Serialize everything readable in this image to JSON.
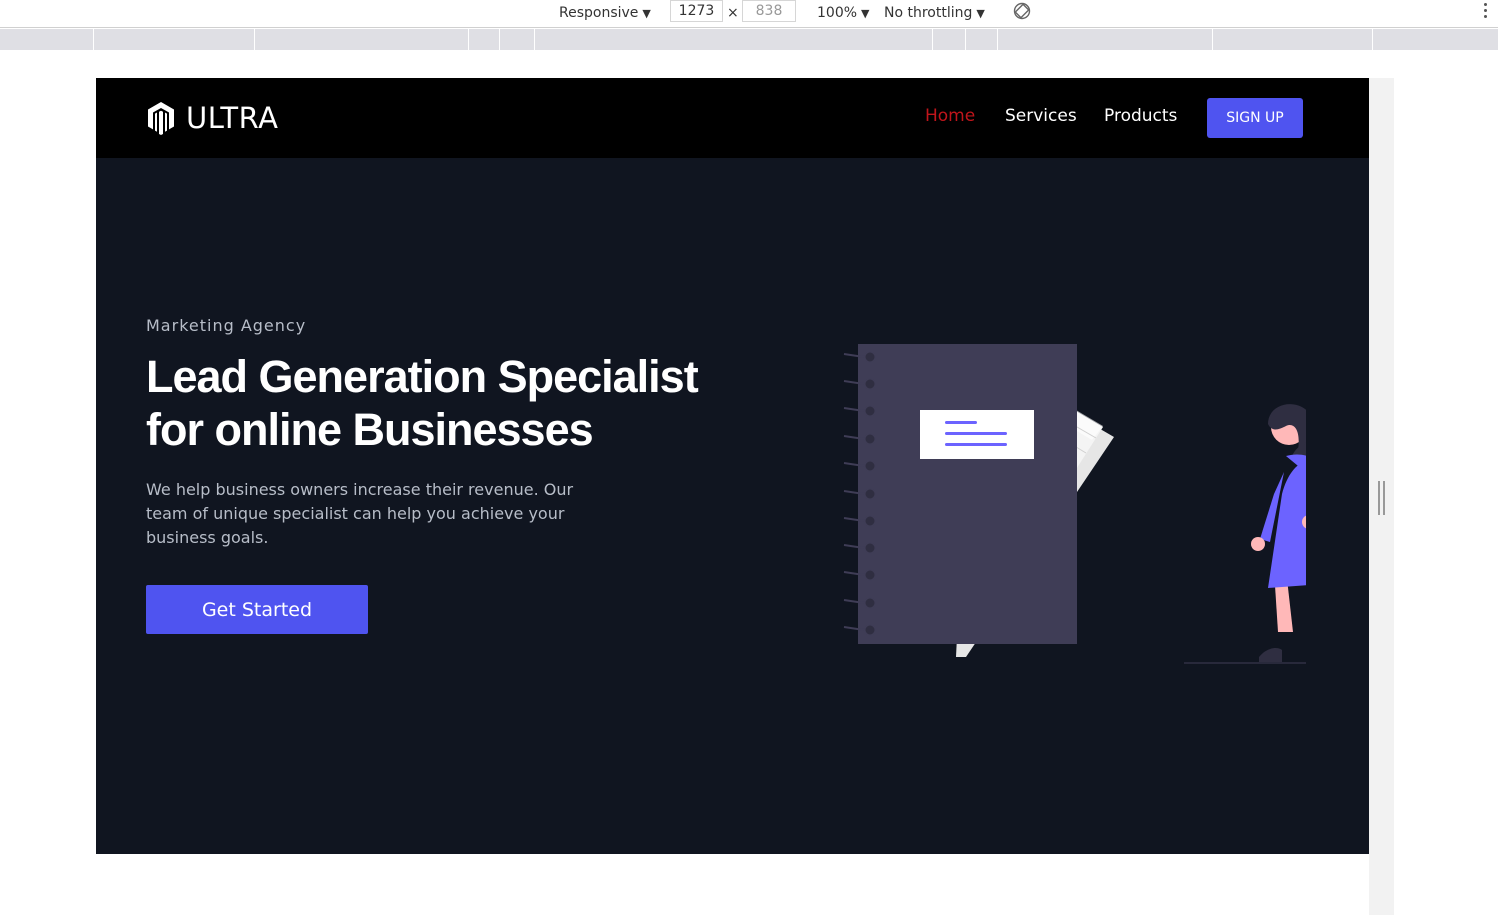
{
  "devtools": {
    "device_mode": "Responsive",
    "width": "1273",
    "height": "838",
    "times_symbol": "×",
    "zoom": "100%",
    "throttling": "No throttling"
  },
  "site": {
    "brand": "ULTRA",
    "nav": [
      {
        "label": "Home",
        "active": true
      },
      {
        "label": "Services",
        "active": false
      },
      {
        "label": "Products",
        "active": false
      }
    ],
    "signup_label": "SIGN UP"
  },
  "hero": {
    "eyebrow": "Marketing Agency",
    "headline_line1": "Lead Generation Specialist",
    "headline_line2": "for online Businesses",
    "lede": "We help business owners increase their revenue. Our team of unique specialist can help you achieve your business goals.",
    "cta_label": "Get Started"
  },
  "colors": {
    "nav_bg": "#000000",
    "hero_bg": "#101520",
    "accent": "#4f54f0",
    "active_link": "#c0151b",
    "notebook": "#3f3d56",
    "figure_dress": "#6c63ff",
    "skin": "#ffb8b8"
  }
}
